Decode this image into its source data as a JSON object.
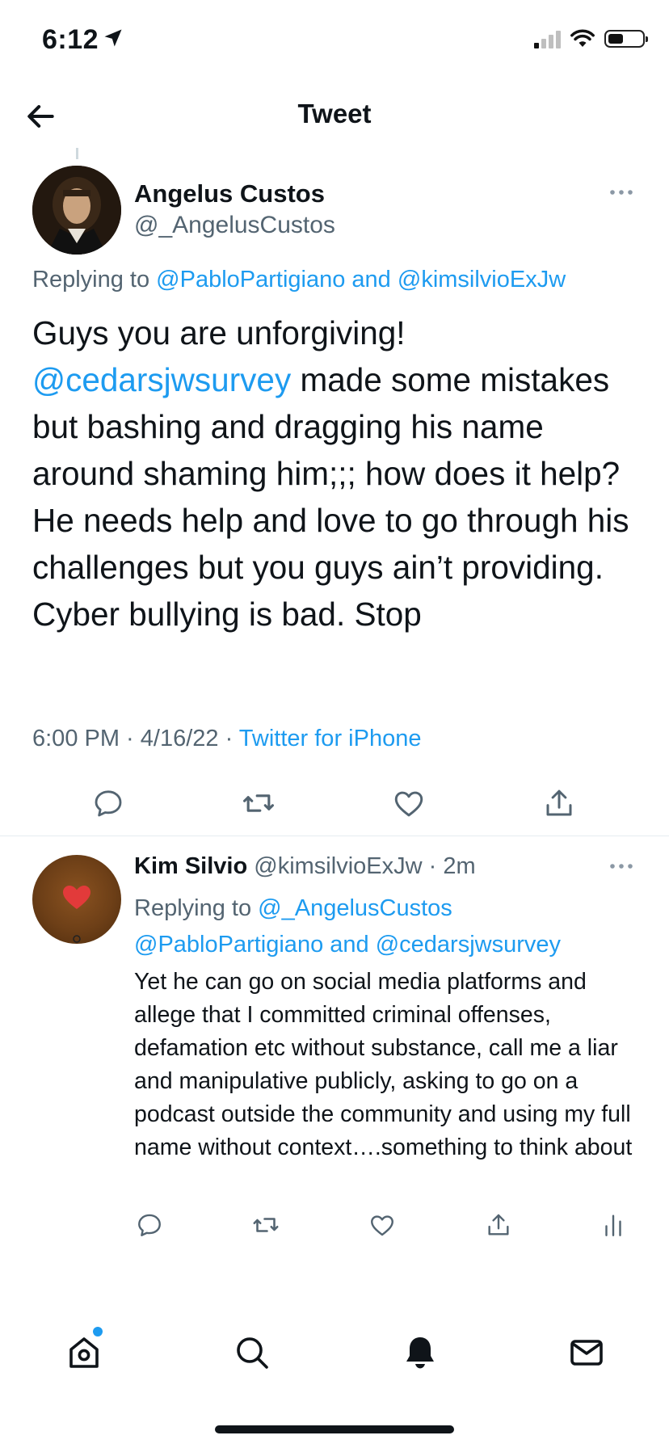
{
  "status_bar": {
    "time": "6:12"
  },
  "header": {
    "title": "Tweet"
  },
  "main_tweet": {
    "author_name": "Angelus Custos",
    "author_handle": "@_AngelusCustos",
    "replying_prefix": "Replying to",
    "replying_user1": "@PabloPartigiano",
    "replying_and": "and",
    "replying_user2": "@kimsilvioExJw",
    "body_lead": "Guys you are unforgiving!",
    "body_mention": "@cedarsjwsurvey",
    "body_rest": " made some mistakes but bashing and dragging his name around shaming him;;; how does it help? He needs help and love to go through his challenges but you guys ain’t providing. Cyber bullying is bad. Stop",
    "time": "6:00 PM",
    "date": "4/16/22",
    "source": "Twitter for iPhone"
  },
  "reply_tweet": {
    "author_name": "Kim Silvio",
    "author_handle": "@kimsilvioExJw",
    "age": "2m",
    "replying_prefix": "Replying to",
    "replying_user1": "@_AngelusCustos",
    "replying_user2": "@PabloPartigiano",
    "replying_and": "and",
    "replying_user3": "@cedarsjwsurvey",
    "body": "Yet he can go on social media platforms and allege that I committed criminal offenses, defamation etc without substance, call me a liar and manipulative publicly, asking to go on a podcast outside the community and using my full name without context….something to think about"
  },
  "icons": {
    "back": "arrow-left-icon",
    "more": "more-dots-icon",
    "reply": "reply-icon",
    "retweet": "retweet-icon",
    "like": "heart-icon",
    "share": "share-icon",
    "analytics": "analytics-icon",
    "home": "home-icon",
    "search": "search-icon",
    "notifications": "bell-icon",
    "messages": "mail-icon"
  },
  "colors": {
    "accent": "#1d9bf0",
    "text": "#0f1419",
    "secondary": "#536471"
  }
}
